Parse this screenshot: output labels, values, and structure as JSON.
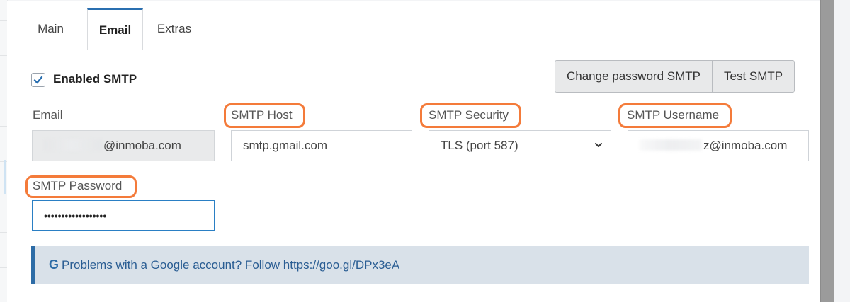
{
  "tabs": [
    {
      "label": "Main"
    },
    {
      "label": "Email",
      "active": true
    },
    {
      "label": "Extras"
    }
  ],
  "smtp": {
    "enabled_label": "Enabled SMTP",
    "enabled": true,
    "change_password_label": "Change password SMTP",
    "test_label": "Test SMTP"
  },
  "fields": {
    "email": {
      "label": "Email",
      "value": "@inmoba.com"
    },
    "host": {
      "label": "SMTP Host",
      "value": "smtp.gmail.com"
    },
    "security": {
      "label": "SMTP Security",
      "value": "TLS (port 587)"
    },
    "username": {
      "label": "SMTP Username",
      "value": "z@inmoba.com"
    },
    "password": {
      "label": "SMTP Password",
      "value": "••••••••••••••••••"
    }
  },
  "alert": {
    "icon": "google-g-icon",
    "text": "Problems with a Google account? Follow https://goo.gl/DPx3eA"
  },
  "colors": {
    "highlight": "#f47b3a",
    "accent": "#2a6fb0",
    "alert_bg": "#d9e1e9",
    "alert_text": "#2a5d93"
  }
}
